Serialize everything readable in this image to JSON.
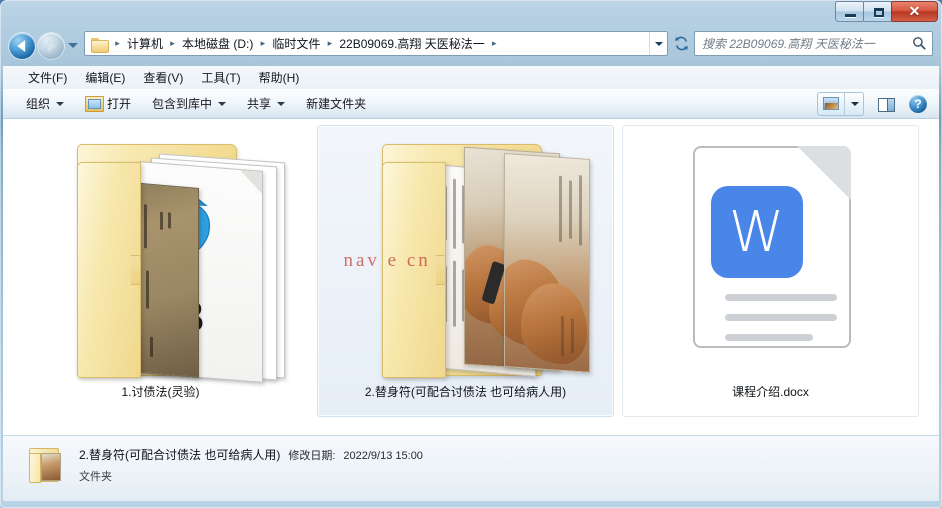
{
  "window": {
    "controls": {
      "minimize": "−",
      "maximize": "□",
      "close": "✕"
    }
  },
  "navigation": {
    "back_label": "后退",
    "forward_label": "前进",
    "recent_pages_label": "最近浏览的位置",
    "refresh_label": "刷新"
  },
  "address_bar": {
    "folder_icon": "folder-icon",
    "separator": "▸",
    "crumbs": [
      {
        "label": "计算机"
      },
      {
        "label": "本地磁盘 (D:)"
      },
      {
        "label": "临时文件"
      },
      {
        "label": "22B09069.高翔 天医秘法一"
      }
    ],
    "dropdown_label": "▼"
  },
  "search": {
    "placeholder": "搜索 22B09069.高翔 天医秘法一",
    "icon": "search-icon"
  },
  "menu": {
    "items": [
      {
        "label": "文件(F)"
      },
      {
        "label": "编辑(E)"
      },
      {
        "label": "查看(V)"
      },
      {
        "label": "工具(T)"
      },
      {
        "label": "帮助(H)"
      }
    ]
  },
  "toolbar": {
    "organize": "组织",
    "open": "打开",
    "include_in_library": "包含到库中",
    "share": "共享",
    "new_folder": "新建文件夹",
    "view_icon": "view-thumbnails-icon",
    "view_caret": "▼",
    "preview_pane_icon": "preview-pane-icon",
    "help_icon": "?"
  },
  "content": {
    "items": [
      {
        "name": "1.讨债法(灵验)",
        "type": "folder",
        "selected": false,
        "thumb_number": "3"
      },
      {
        "name": "2.替身符(可配合讨债法 也可给病人用)",
        "type": "folder",
        "selected": true,
        "watermark": "nav  e cn"
      },
      {
        "name": "课程介绍.docx",
        "type": "docx",
        "selected": false,
        "icon_letter": "W"
      }
    ]
  },
  "details_pane": {
    "name": "2.替身符(可配合讨债法 也可给病人用)",
    "modified_label": "修改日期:",
    "modified_value": "2022/9/13 15:00",
    "type": "文件夹",
    "icon": "folder-icon"
  },
  "colors": {
    "accent_blue": "#4a86e8",
    "titlebar_blue": "#7fa9c9",
    "close_red": "#b8351f",
    "folder_yellow": "#f3dd95",
    "selection_bg": "#e6eef6"
  }
}
